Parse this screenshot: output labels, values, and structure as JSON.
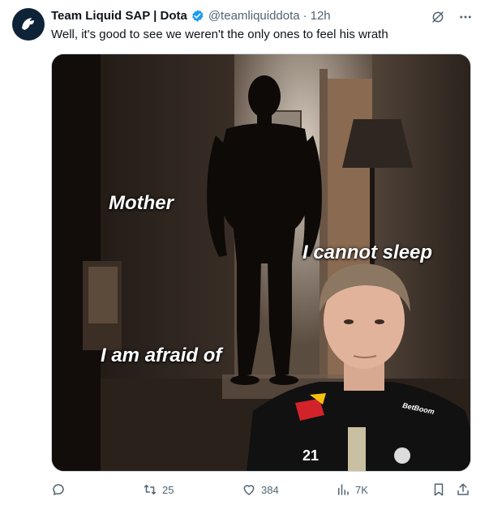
{
  "tweet": {
    "display_name": "Team Liquid SAP | Dota",
    "handle": "@teamliquiddota",
    "separator": "·",
    "time": "12h",
    "text": "Well, it's good to see we weren't the only ones to feel his wrath",
    "avatar_icon": "team-liquid-horse-logo",
    "verified": true
  },
  "media": {
    "captions": {
      "top_left": "Mother",
      "right": "I cannot sleep",
      "bottom_left": "I am afraid of"
    },
    "jersey_number": "21",
    "sponsor_text": "BetBoom"
  },
  "actions": {
    "reply_count": "",
    "retweet_count": "25",
    "like_count": "384",
    "views_count": "7K"
  },
  "colors": {
    "text": "#0f1419",
    "muted": "#536471",
    "verified_blue": "#1d9bf0"
  }
}
